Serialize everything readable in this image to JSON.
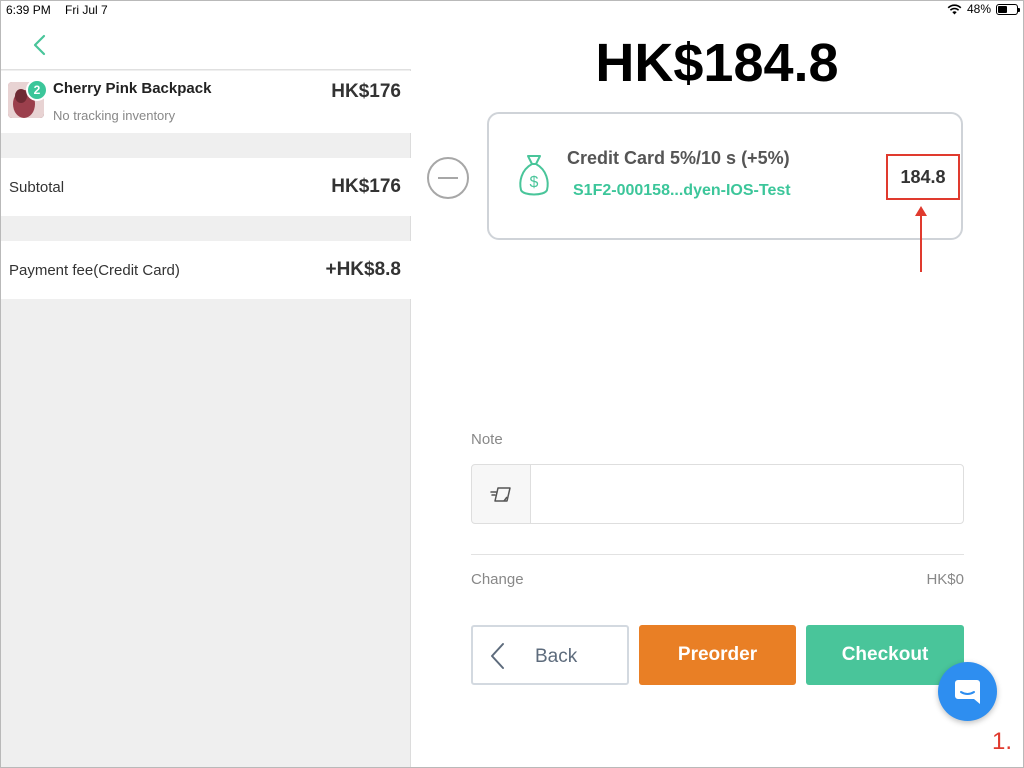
{
  "status_bar": {
    "time": "6:39 PM",
    "date": "Fri Jul 7",
    "battery": "48%",
    "battery_level": 0.48,
    "icons": [
      "wifi-icon",
      "battery-icon"
    ]
  },
  "left_panel": {
    "item": {
      "quantity": "2",
      "name": "Cherry Pink Backpack",
      "subtitle": "No tracking inventory",
      "price": "HK$176"
    },
    "subtotal": {
      "label": "Subtotal",
      "value": "HK$176"
    },
    "payment_fee": {
      "label": "Payment fee(Credit Card)",
      "value": "+HK$8.8"
    }
  },
  "main": {
    "total": "HK$184.8",
    "payment": {
      "method": "Credit Card 5%/10   s (+5%)",
      "reference": "S1F2-000158...dyen-IOS-Test",
      "amount": "184.8"
    },
    "note": {
      "label": "Note",
      "value": "",
      "placeholder": ""
    },
    "change": {
      "label": "Change",
      "value": "HK$0"
    },
    "buttons": {
      "back": "Back",
      "preorder": "Preorder",
      "checkout": "Checkout"
    }
  },
  "annotation": {
    "step": "1."
  },
  "colors": {
    "accent_green": "#49c59a",
    "preorder_orange": "#e97f25",
    "highlight_red": "#e03a2e",
    "chat_blue": "#2e8ef0"
  }
}
